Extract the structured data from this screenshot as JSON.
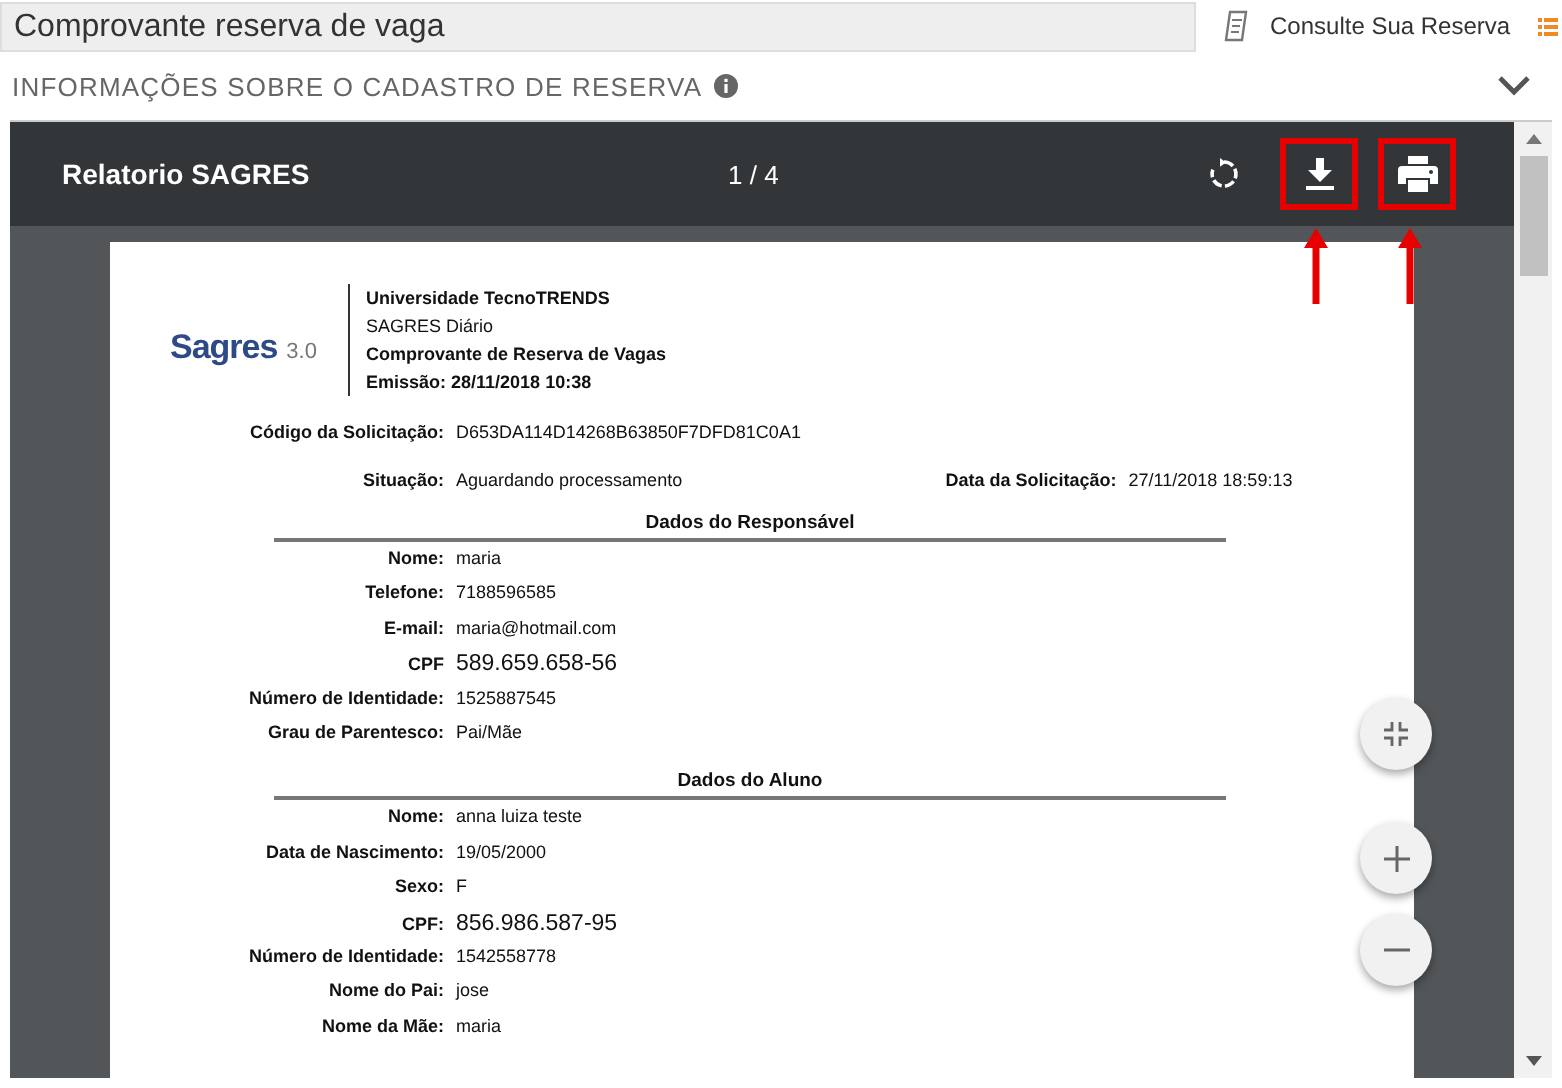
{
  "header": {
    "title": "Comprovante reserva de vaga",
    "tab": "Consulte Sua Reserva"
  },
  "section": {
    "title": "INFORMAÇÕES SOBRE O CADASTRO DE RESERVA"
  },
  "viewer": {
    "title": "Relatorio SAGRES",
    "page": "1 / 4",
    "tools": [
      {
        "kind": "rotate",
        "highlighted": false
      },
      {
        "kind": "download",
        "highlighted": true
      },
      {
        "kind": "print",
        "highlighted": true
      }
    ]
  },
  "document": {
    "logo": {
      "name": "Sagres",
      "version": "3.0"
    },
    "header_lines": [
      {
        "text": "Universidade TecnoTRENDS",
        "bold": true
      },
      {
        "text": "SAGRES Diário",
        "bold": false
      },
      {
        "text": "Comprovante de Reserva de Vagas",
        "bold": true
      },
      {
        "text": "Emissão: 28/11/2018 10:38",
        "bold": true
      }
    ],
    "code": {
      "label": "Código da Solicitação:",
      "value": "D653DA114D14268B63850F7DFD81C0A1"
    },
    "status": {
      "label": "Situação:",
      "value": "Aguardando processamento"
    },
    "date": {
      "label": "Data da Solicitação:",
      "value": "27/11/2018 18:59:13"
    },
    "sections": [
      {
        "title": "Dados do Responsável",
        "fields": [
          {
            "label": "Nome:",
            "value": "maria",
            "large": false
          },
          {
            "label": "Telefone:",
            "value": "7188596585",
            "large": false
          },
          {
            "label": "E-mail:",
            "value": "maria@hotmail.com",
            "large": false
          },
          {
            "label": "CPF",
            "value": "589.659.658-56",
            "large": true
          },
          {
            "label": "Número de Identidade:",
            "value": "1525887545",
            "large": false
          },
          {
            "label": "Grau de Parentesco:",
            "value": "Pai/Mãe",
            "large": false
          }
        ]
      },
      {
        "title": "Dados do Aluno",
        "fields": [
          {
            "label": "Nome:",
            "value": "anna luiza teste",
            "large": false
          },
          {
            "label": "Data de Nascimento:",
            "value": "19/05/2000",
            "large": false
          },
          {
            "label": "Sexo:",
            "value": "F",
            "large": false
          },
          {
            "label": "CPF:",
            "value": "856.986.587-95",
            "large": true
          },
          {
            "label": "Número de Identidade:",
            "value": "1542558778",
            "large": false
          },
          {
            "label": "Nome do Pai:",
            "value": "jose",
            "large": false
          },
          {
            "label": "Nome da Mãe:",
            "value": "maria",
            "large": false
          }
        ]
      }
    ]
  }
}
